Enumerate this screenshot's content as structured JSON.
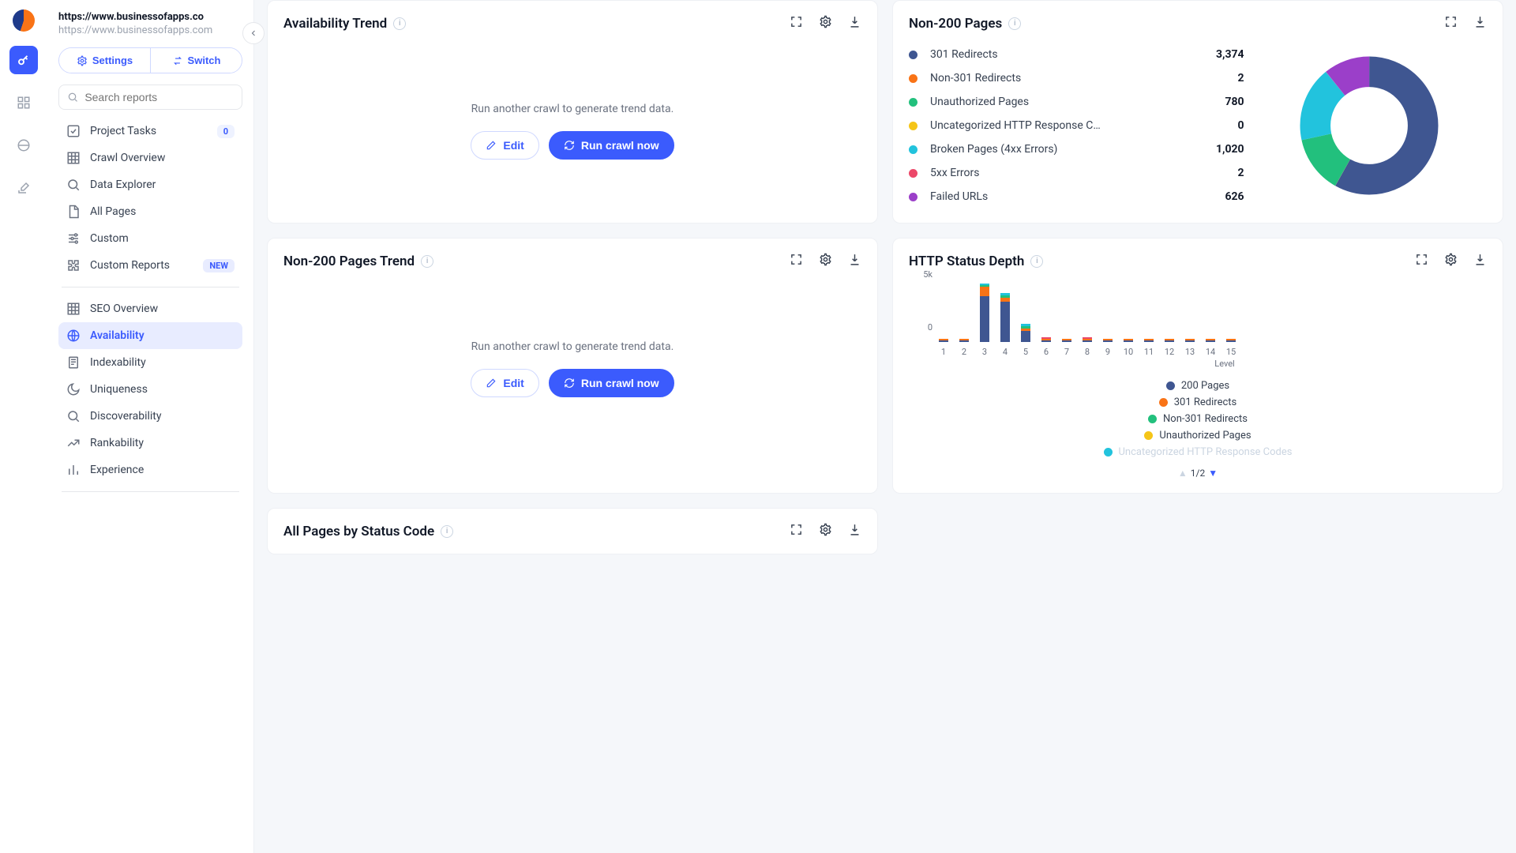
{
  "site": {
    "primary": "https://www.businessofapps.co",
    "secondary": "https://www.businessofapps.com"
  },
  "sidebar": {
    "settings": "Settings",
    "switch": "Switch",
    "search_placeholder": "Search reports",
    "group1": [
      {
        "label": "Project Tasks",
        "icon": "check",
        "badge": "0"
      },
      {
        "label": "Crawl Overview",
        "icon": "grid"
      },
      {
        "label": "Data Explorer",
        "icon": "search"
      },
      {
        "label": "All Pages",
        "icon": "page"
      },
      {
        "label": "Custom",
        "icon": "sliders"
      },
      {
        "label": "Custom Reports",
        "icon": "puzzle",
        "badge": "NEW"
      }
    ],
    "group2": [
      {
        "label": "SEO Overview",
        "icon": "grid"
      },
      {
        "label": "Availability",
        "icon": "globe",
        "active": true
      },
      {
        "label": "Indexability",
        "icon": "file"
      },
      {
        "label": "Uniqueness",
        "icon": "moon"
      },
      {
        "label": "Discoverability",
        "icon": "search"
      },
      {
        "label": "Rankability",
        "icon": "trend"
      },
      {
        "label": "Experience",
        "icon": "bars"
      }
    ]
  },
  "cards": {
    "availability_trend": {
      "title": "Availability Trend",
      "empty_msg": "Run another crawl to generate trend data.",
      "edit": "Edit",
      "run": "Run crawl now"
    },
    "non200": {
      "title": "Non-200 Pages",
      "items": [
        {
          "label": "301 Redirects",
          "value": "3,374",
          "color": "#3f5691"
        },
        {
          "label": "Non-301 Redirects",
          "value": "2",
          "color": "#f97316"
        },
        {
          "label": "Unauthorized Pages",
          "value": "780",
          "color": "#22c07d"
        },
        {
          "label": "Uncategorized HTTP Response C…",
          "value": "0",
          "color": "#f5c518"
        },
        {
          "label": "Broken Pages (4xx Errors)",
          "value": "1,020",
          "color": "#22c3dd"
        },
        {
          "label": "5xx Errors",
          "value": "2",
          "color": "#ec4869"
        },
        {
          "label": "Failed URLs",
          "value": "626",
          "color": "#9b3fc9"
        }
      ]
    },
    "non200_trend": {
      "title": "Non-200 Pages Trend",
      "empty_msg": "Run another crawl to generate trend data.",
      "edit": "Edit",
      "run": "Run crawl now"
    },
    "http_depth": {
      "title": "HTTP Status Depth",
      "ylabels": {
        "top": "5k",
        "bottom": "0"
      },
      "xtitle": "Level",
      "legend": [
        {
          "label": "200 Pages",
          "color": "#3f5691"
        },
        {
          "label": "301 Redirects",
          "color": "#f97316"
        },
        {
          "label": "Non-301 Redirects",
          "color": "#22c07d"
        },
        {
          "label": "Unauthorized Pages",
          "color": "#f5c518"
        }
      ],
      "legend_cut": "Uncategorized HTTP Response Codes",
      "pager": "1/2"
    },
    "all_pages_status": {
      "title": "All Pages by Status Code"
    }
  },
  "chart_data": [
    {
      "type": "pie",
      "title": "Non-200 Pages",
      "series": [
        {
          "name": "301 Redirects",
          "value": 3374,
          "color": "#3f5691"
        },
        {
          "name": "Non-301 Redirects",
          "value": 2,
          "color": "#f97316"
        },
        {
          "name": "Unauthorized Pages",
          "value": 780,
          "color": "#22c07d"
        },
        {
          "name": "Uncategorized HTTP Response Codes",
          "value": 0,
          "color": "#f5c518"
        },
        {
          "name": "Broken Pages (4xx Errors)",
          "value": 1020,
          "color": "#22c3dd"
        },
        {
          "name": "5xx Errors",
          "value": 2,
          "color": "#ec4869"
        },
        {
          "name": "Failed URLs",
          "value": 626,
          "color": "#9b3fc9"
        }
      ]
    },
    {
      "type": "bar",
      "title": "HTTP Status Depth",
      "xlabel": "Level",
      "ylabel": "",
      "ylim": [
        0,
        5000
      ],
      "categories": [
        1,
        2,
        3,
        4,
        5,
        6,
        7,
        8,
        9,
        10,
        11,
        12,
        13,
        14,
        15
      ],
      "series": [
        {
          "name": "200 Pages",
          "color": "#3f5691",
          "values": [
            50,
            40,
            3600,
            3200,
            900,
            30,
            30,
            30,
            30,
            60,
            60,
            60,
            60,
            60,
            60
          ]
        },
        {
          "name": "301 Redirects",
          "color": "#f97316",
          "values": [
            60,
            50,
            750,
            300,
            180,
            60,
            60,
            60,
            50,
            50,
            50,
            50,
            50,
            50,
            50
          ]
        },
        {
          "name": "Non-301 Redirects",
          "color": "#22c07d",
          "values": [
            0,
            0,
            160,
            160,
            160,
            0,
            0,
            0,
            0,
            0,
            0,
            0,
            0,
            0,
            0
          ]
        },
        {
          "name": "Unauthorized Pages",
          "color": "#f5c518",
          "values": [
            0,
            0,
            0,
            0,
            0,
            0,
            0,
            0,
            0,
            0,
            0,
            0,
            0,
            0,
            0
          ]
        },
        {
          "name": "Broken Pages (4xx)",
          "color": "#22c3dd",
          "values": [
            0,
            0,
            100,
            220,
            220,
            0,
            0,
            0,
            0,
            0,
            0,
            0,
            0,
            0,
            0
          ]
        },
        {
          "name": "5xx Errors",
          "color": "#ec4869",
          "values": [
            0,
            0,
            0,
            0,
            0,
            30,
            0,
            30,
            0,
            0,
            0,
            0,
            0,
            0,
            0
          ]
        }
      ]
    }
  ]
}
